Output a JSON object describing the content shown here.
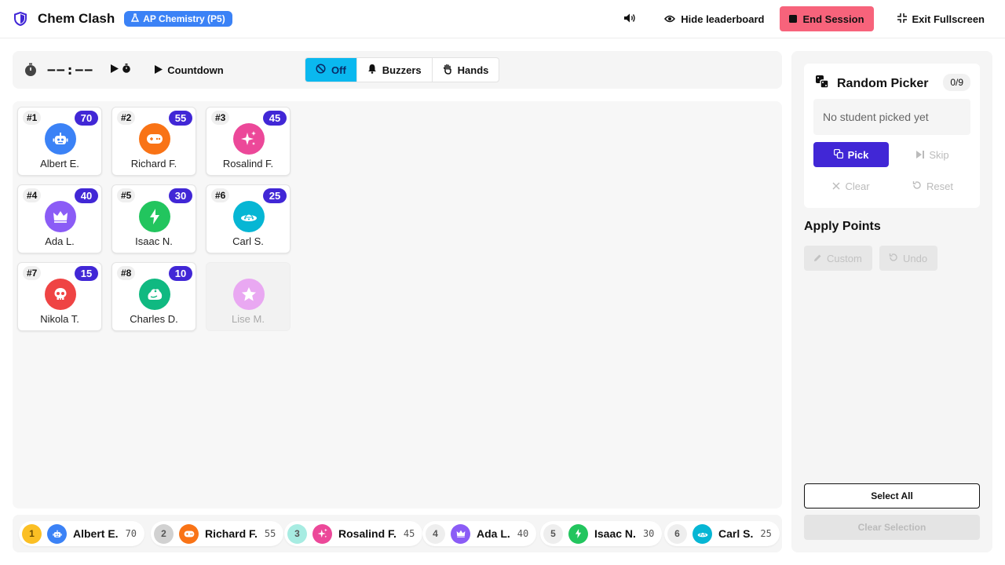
{
  "header": {
    "title": "Chem Clash",
    "class_badge": "AP Chemistry (P5)",
    "hide_leaderboard": "Hide leaderboard",
    "end_session": "End Session",
    "exit_fullscreen": "Exit Fullscreen"
  },
  "toolbar": {
    "timer": "−−:−−",
    "countdown": "Countdown",
    "modes": [
      "Off",
      "Buzzers",
      "Hands"
    ],
    "active_mode": "Off"
  },
  "students": [
    {
      "rank": "#1",
      "score": "70",
      "name": "Albert E.",
      "color": "#3b82f6",
      "icon": "robot-icon"
    },
    {
      "rank": "#2",
      "score": "55",
      "name": "Richard F.",
      "color": "#f97316",
      "icon": "gamepad-icon"
    },
    {
      "rank": "#3",
      "score": "45",
      "name": "Rosalind F.",
      "color": "#ec4899",
      "icon": "sparkles-icon"
    },
    {
      "rank": "#4",
      "score": "40",
      "name": "Ada L.",
      "color": "#8b5cf6",
      "icon": "crown-icon"
    },
    {
      "rank": "#5",
      "score": "30",
      "name": "Isaac N.",
      "color": "#22c55e",
      "icon": "bolt-icon"
    },
    {
      "rank": "#6",
      "score": "25",
      "name": "Carl S.",
      "color": "#06b6d4",
      "icon": "ufo-icon"
    },
    {
      "rank": "#7",
      "score": "15",
      "name": "Nikola T.",
      "color": "#ef4444",
      "icon": "skull-icon"
    },
    {
      "rank": "#8",
      "score": "10",
      "name": "Charles D.",
      "color": "#10b981",
      "icon": "frog-icon"
    },
    {
      "rank": "",
      "score": "",
      "name": "Lise M.",
      "color": "#e9a8f2",
      "icon": "star-icon",
      "inactive": true
    }
  ],
  "leaderboard": [
    {
      "rank": "1",
      "name": "Albert E.",
      "score": "70",
      "rank_color": "#fbbf24",
      "color": "#3b82f6"
    },
    {
      "rank": "2",
      "name": "Richard F.",
      "score": "55",
      "rank_color": "#d1d1d1",
      "color": "#f97316"
    },
    {
      "rank": "3",
      "name": "Rosalind F.",
      "score": "45",
      "rank_color": "#a7ece2",
      "color": "#ec4899"
    },
    {
      "rank": "4",
      "name": "Ada L.",
      "score": "40",
      "rank_color": "#eeeeee",
      "color": "#8b5cf6"
    },
    {
      "rank": "5",
      "name": "Isaac N.",
      "score": "30",
      "rank_color": "#eeeeee",
      "color": "#22c55e"
    },
    {
      "rank": "6",
      "name": "Carl S.",
      "score": "25",
      "rank_color": "#eeeeee",
      "color": "#06b6d4"
    }
  ],
  "picker": {
    "title": "Random Picker",
    "count": "0/9",
    "result": "No student picked yet",
    "pick": "Pick",
    "skip": "Skip",
    "clear": "Clear",
    "reset": "Reset"
  },
  "apply_points": {
    "title": "Apply Points",
    "custom": "Custom",
    "undo": "Undo"
  },
  "selection": {
    "select_all": "Select All",
    "clear_selection": "Clear Selection"
  },
  "colors": {
    "accent": "#4127d6",
    "end_session": "#f7637b",
    "mode_active": "#0ab8ef",
    "class_badge": "#3b82f6"
  }
}
